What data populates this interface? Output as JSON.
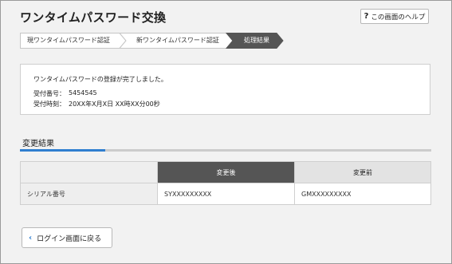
{
  "page": {
    "title": "ワンタイムパスワード交換",
    "help_label": "この画面のヘルプ",
    "help_icon": "question-mark-icon"
  },
  "steps": [
    {
      "label": "現ワンタイムパスワード認証",
      "state": "done"
    },
    {
      "label": "新ワンタイムパスワード認証",
      "state": "done"
    },
    {
      "label": "処理結果",
      "state": "current"
    }
  ],
  "result": {
    "message": "ワンタイムパスワードの登録が完了しました。",
    "receipt_number_label": "受付番号：",
    "receipt_number": "5454545",
    "receipt_time_label": "受付時刻：",
    "receipt_time": "20XX年X月X日 XX時XX分00秒"
  },
  "change_section": {
    "title": "変更結果",
    "columns": [
      "",
      "変更後",
      "変更前"
    ],
    "rows": [
      {
        "label": "シリアル番号",
        "after": "SYXXXXXXXXX",
        "before": "GMXXXXXXXXX"
      }
    ]
  },
  "actions": {
    "back_label": "ログイン画面に戻る",
    "back_icon": "chevron-left-icon"
  },
  "colors": {
    "accent": "#2f7fd0",
    "active_step": "#555555",
    "panel_background": "#f2f2f2"
  }
}
